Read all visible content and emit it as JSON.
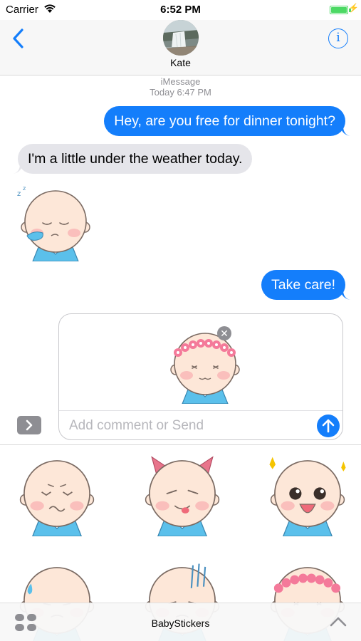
{
  "status_bar": {
    "carrier": "Carrier",
    "time": "6:52 PM"
  },
  "header": {
    "contact_name": "Kate",
    "info_label": "i"
  },
  "conversation": {
    "service_label": "iMessage",
    "timestamp_prefix": "Today",
    "timestamp_time": "6:47 PM",
    "messages": [
      {
        "direction": "outgoing",
        "text": "Hey, are you free for dinner tonight?"
      },
      {
        "direction": "incoming",
        "text": "I'm a little under the weather today."
      },
      {
        "direction": "incoming",
        "type": "sticker",
        "sticker": "sleepy-baby-sticker"
      },
      {
        "direction": "outgoing",
        "text": "Take care!"
      }
    ]
  },
  "compose": {
    "staged_sticker": "flower-crown-baby-sticker",
    "placeholder": "Add comment or Send"
  },
  "sticker_drawer": {
    "stickers": [
      "frowning-baby-sticker",
      "devil-horns-baby-sticker",
      "excited-baby-sticker",
      "sweating-baby-sticker",
      "gloomy-baby-sticker",
      "flower-crown-baby-sticker"
    ],
    "app_name": "BabyStickers"
  },
  "colors": {
    "imessage_blue": "#147efb",
    "incoming_gray": "#e5e5ea",
    "battery_green": "#4cd964",
    "baby_shirt": "#5bc0eb"
  }
}
